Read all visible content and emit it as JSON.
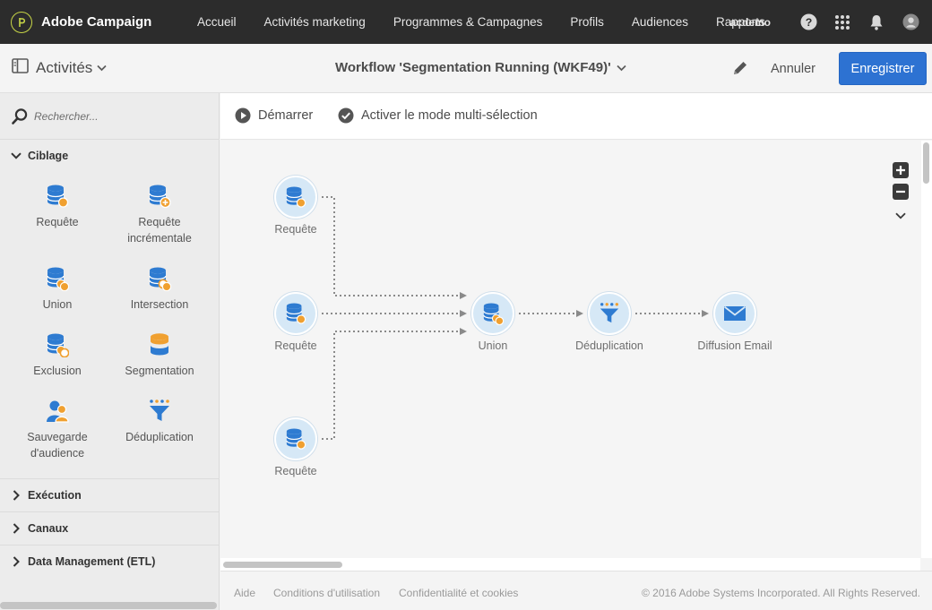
{
  "app": {
    "name": "Adobe Campaign",
    "nav": [
      "Accueil",
      "Activités marketing",
      "Programmes & Campagnes",
      "Profils",
      "Audiences",
      "Rapports"
    ],
    "user": "acdemo"
  },
  "actionbar": {
    "panel_title": "Activités",
    "workflow_title": "Workflow 'Segmentation Running (WKF49)'",
    "cancel_label": "Annuler",
    "save_label": "Enregistrer"
  },
  "sidebar": {
    "search_placeholder": "Rechercher...",
    "categories": [
      {
        "label": "Ciblage",
        "expanded": true
      },
      {
        "label": "Exécution",
        "expanded": false
      },
      {
        "label": "Canaux",
        "expanded": false
      },
      {
        "label": "Data Management (ETL)",
        "expanded": false
      }
    ],
    "items": [
      {
        "label": "Requête",
        "icon": "query-icon"
      },
      {
        "label": "Requête incrémentale",
        "icon": "incremental-query-icon"
      },
      {
        "label": "Union",
        "icon": "union-icon"
      },
      {
        "label": "Intersection",
        "icon": "intersection-icon"
      },
      {
        "label": "Exclusion",
        "icon": "exclusion-icon"
      },
      {
        "label": "Segmentation",
        "icon": "segmentation-icon"
      },
      {
        "label": "Sauvegarde d'audience",
        "icon": "save-audience-icon"
      },
      {
        "label": "Déduplication",
        "icon": "deduplication-icon"
      }
    ]
  },
  "canvas": {
    "start_label": "Démarrer",
    "multiselect_label": "Activer le mode multi-sélection",
    "nodes": [
      {
        "label": "Requête",
        "icon": "query-icon"
      },
      {
        "label": "Requête",
        "icon": "query-icon"
      },
      {
        "label": "Requête",
        "icon": "query-icon"
      },
      {
        "label": "Union",
        "icon": "union-icon"
      },
      {
        "label": "Déduplication",
        "icon": "deduplication-icon"
      },
      {
        "label": "Diffusion Email",
        "icon": "email-icon"
      }
    ]
  },
  "footer": {
    "links": [
      "Aide",
      "Conditions d'utilisation",
      "Confidentialité et cookies"
    ],
    "copyright": "© 2016 Adobe Systems Incorporated. All Rights Reserved."
  },
  "colors": {
    "nav_bg": "#2c2c2c",
    "accent": "#2d72d2",
    "icon_blue": "#2e7bd1",
    "icon_orange": "#f0a030",
    "node_bg": "#d6e8f6"
  }
}
